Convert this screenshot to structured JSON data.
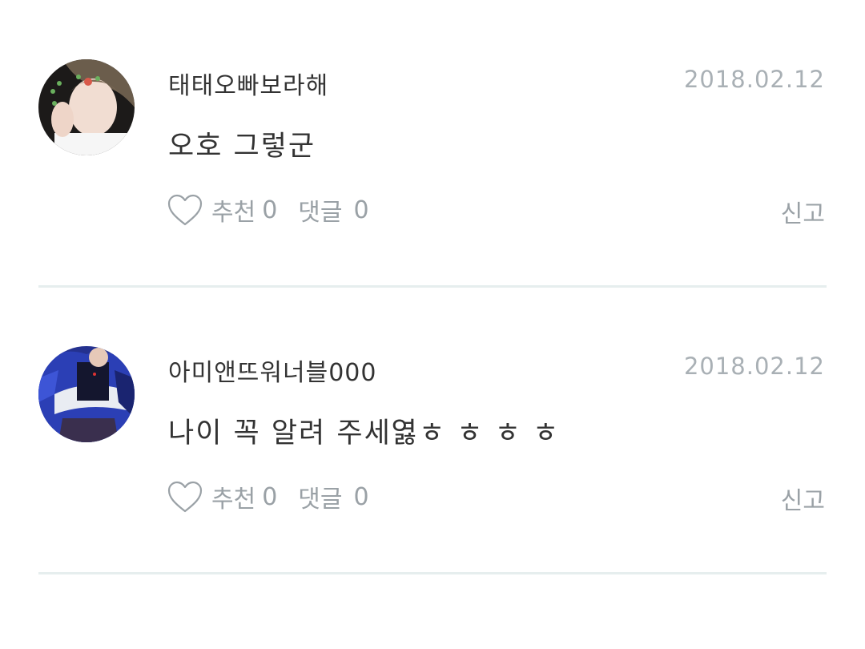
{
  "comments": [
    {
      "username": "태태오빠보라해",
      "date": "2018.02.12",
      "text": "오호 그렇군",
      "like_label": "추천",
      "like_count": "0",
      "reply_label": "댓글",
      "reply_count": "0",
      "report_label": "신고",
      "like_icon": "heart-outline-icon"
    },
    {
      "username": "아미앤뜨워너블000",
      "date": "2018.02.12",
      "text": "나이 꼭 알려 주세엻ㅎ ㅎ ㅎ ㅎ",
      "like_label": "추천",
      "like_count": "0",
      "reply_label": "댓글",
      "reply_count": "0",
      "report_label": "신고",
      "like_icon": "heart-outline-icon"
    }
  ],
  "colors": {
    "primary_text": "#333333",
    "muted_text": "#9aa1a6",
    "date_text": "#a9b0b5",
    "divider": "#e6eeee"
  }
}
